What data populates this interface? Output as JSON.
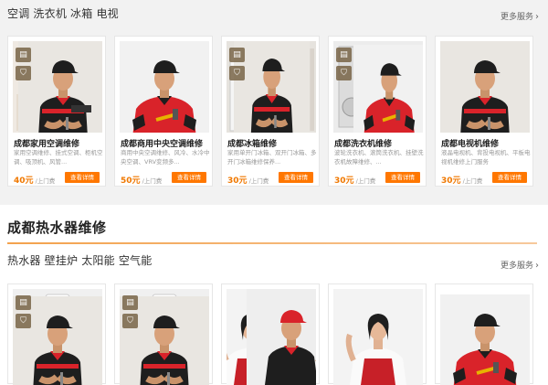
{
  "section1": {
    "subcategories": "空调 洗衣机 冰箱 电视",
    "more": "更多服务",
    "cards": [
      {
        "title": "成都家用空调维修",
        "desc": "家用空调维修、挂式空调、柜机空调、吸顶机、风管...",
        "price": "40元",
        "unit": "/上门费",
        "button": "查看详情"
      },
      {
        "title": "成都商用中央空调维修",
        "desc": "商用中央空调维修、风冷、水冷中央空调、VRV变频多...",
        "price": "50元",
        "unit": "/上门费",
        "button": "查看详情"
      },
      {
        "title": "成都冰箱维修",
        "desc": "家用单开门冰箱、双开门冰箱、多开门冰箱维修保养...",
        "price": "30元",
        "unit": "/上门费",
        "button": "查看详情"
      },
      {
        "title": "成都洗衣机维修",
        "desc": "波轮洗衣机、滚筒洗衣机、挂壁洗衣机故障维修、...",
        "price": "30元",
        "unit": "/上门费",
        "button": "查看详情"
      },
      {
        "title": "成都电视机维修",
        "desc": "液晶电视机、背投电视机、平板电视机维修上门服务",
        "price": "30元",
        "unit": "/上门费",
        "button": "查看详情"
      }
    ]
  },
  "section2": {
    "heading": "成都热水器维修",
    "subcategories": "热水器 壁挂炉 太阳能 空气能",
    "more": "更多服务"
  },
  "icons": {
    "badge_top": "document-icon",
    "badge_bottom": "shield-icon",
    "more": "chevron-right-icon"
  },
  "colors": {
    "accent": "#ff7700",
    "price": "#f07800",
    "uniform_red": "#d9232a",
    "uniform_black": "#1e1e1e"
  }
}
